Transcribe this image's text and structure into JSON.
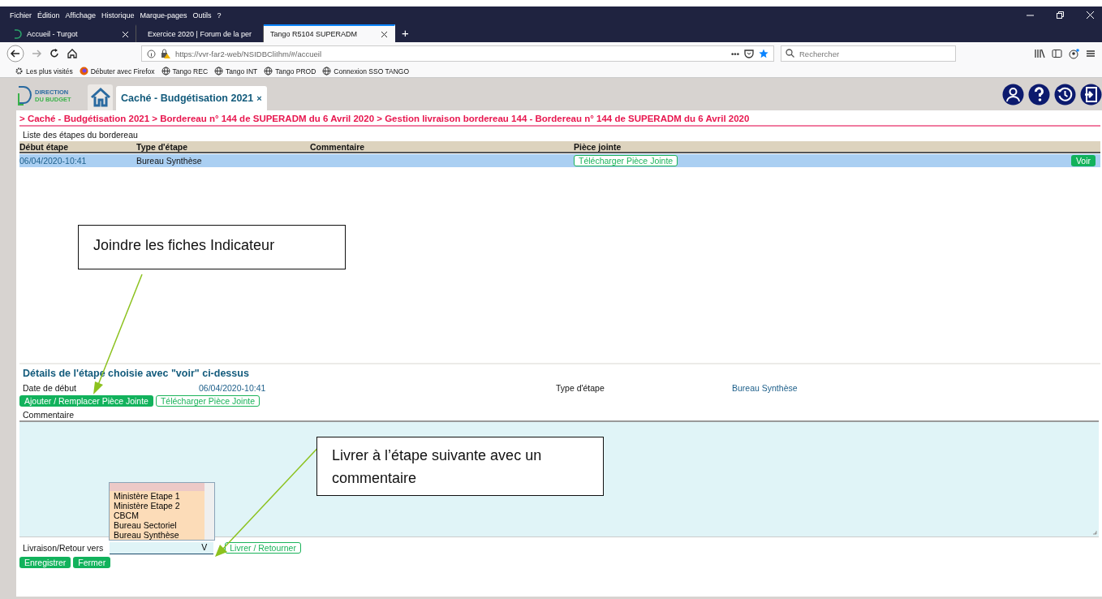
{
  "browser": {
    "menu": [
      "Fichier",
      "Édition",
      "Affichage",
      "Historique",
      "Marque-pages",
      "Outils",
      "?"
    ],
    "tabs": [
      {
        "label": "Accueil - Turgot",
        "selected": false
      },
      {
        "label": "Exercice 2020 | Forum de la per",
        "selected": false
      },
      {
        "label": "Tango R5104 SUPERADM",
        "selected": true
      }
    ],
    "new_tab": "+",
    "url": "https://vvr-far2-web/NSIDBCliIhm/#/accueil",
    "more": "•••",
    "search": {
      "placeholder": "Rechercher"
    },
    "bookmarks": [
      {
        "label": "Les plus visités",
        "kind": "gear"
      },
      {
        "label": "Débuter avec Firefox",
        "kind": "firefox"
      },
      {
        "label": "Tango REC",
        "kind": "globe"
      },
      {
        "label": "Tango INT",
        "kind": "globe"
      },
      {
        "label": "Tango PROD",
        "kind": "globe"
      },
      {
        "label": "Connexion SSO TANGO",
        "kind": "globe"
      }
    ]
  },
  "app": {
    "logo": [
      "DIRECTION",
      "DU BUDGET"
    ],
    "tab": {
      "label": "Caché - Budgétisation 2021",
      "close": "×"
    },
    "breadcrumb": "> Caché - Budgétisation 2021 > Bordereau n° 144 de SUPERADM du 6 Avril 2020 > Gestion livraison bordereau 144 - Bordereau n° 144 de SUPERADM du 6 Avril 2020",
    "list_title": "Liste des étapes du bordereau",
    "table": {
      "columns": [
        "Début étape",
        "Type d'étape",
        "Commentaire",
        "Pièce jointe"
      ],
      "rows": [
        {
          "selected": true,
          "start": "06/04/2020-10:41",
          "type": "Bureau Synthèse",
          "attachment": "Télécharger Pièce Jointe",
          "action": "Voir"
        }
      ]
    },
    "details": {
      "title": "Détails de l'étape choisie avec \"voir\" ci-dessus",
      "date_label": "Date de début",
      "date_value": "06/04/2020-10:41",
      "type_label": "Type d'étape",
      "type_value": "Bureau Synthèse",
      "attach_buttons": [
        {
          "label": "Ajouter / Remplacer Pièce Jointe",
          "kind": "filled"
        },
        {
          "label": "Télécharger Pièce Jointe",
          "kind": "outline"
        }
      ],
      "comment_label": "Commentaire",
      "delivery_label": "Livraison/Retour vers",
      "delivery_select": "V",
      "blank_option_selected": true,
      "delivery_options": [
        "Ministère Etape 1",
        "Ministère Etape 2",
        "CBCM",
        "Bureau Sectoriel",
        "Bureau Synthèse"
      ],
      "deliver_button": "Livrer / Retourner",
      "footer_buttons": [
        "Enregistrer",
        "Fermer"
      ]
    }
  },
  "annotations": [
    {
      "text": "Joindre les fiches Indicateur"
    },
    {
      "text": "Livrer à l’étape suivante avec un commentaire"
    }
  ]
}
